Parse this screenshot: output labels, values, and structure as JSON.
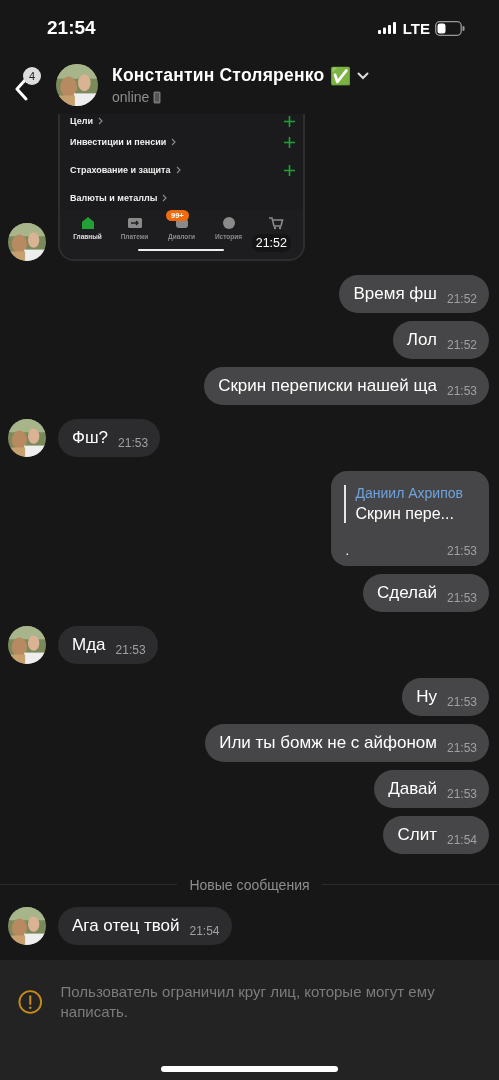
{
  "status_bar": {
    "time": "21:54",
    "network": "LTE"
  },
  "header": {
    "back_badge": "4",
    "name": "Константин Столяренко",
    "name_emoji": "✅",
    "status": "online"
  },
  "messages": [
    {
      "outgoing": false,
      "time": "21:52",
      "screenshot": {
        "rows": [
          "Цели",
          "Инвестиции и пенсии",
          "Страхование и защита",
          "Валюты и металлы"
        ],
        "tabs": [
          {
            "label": "Главный",
            "selected": true
          },
          {
            "label": "Платежи",
            "selected": false
          },
          {
            "label": "Диалоги",
            "selected": false,
            "badge": "99+"
          },
          {
            "label": "История",
            "selected": false
          },
          {
            "selected": false
          }
        ]
      }
    },
    {
      "kind": "text",
      "outgoing": true,
      "text": "Время фш",
      "time": "21:52"
    },
    {
      "kind": "text",
      "outgoing": true,
      "text": "Лол",
      "time": "21:52"
    },
    {
      "kind": "text",
      "outgoing": true,
      "text": "Скрин переписки нашей ща",
      "time": "21:53"
    },
    {
      "kind": "text",
      "outgoing": false,
      "text": "Фш?",
      "time": "21:53"
    },
    {
      "kind": "reply",
      "outgoing": true,
      "reply_author": "Даниил Ахрипов",
      "reply_text": "Скрин пере...",
      "text": ".",
      "time": "21:53"
    },
    {
      "kind": "text",
      "outgoing": true,
      "text": "Сделай",
      "time": "21:53"
    },
    {
      "kind": "text",
      "outgoing": false,
      "text": "Мда",
      "time": "21:53"
    },
    {
      "kind": "text",
      "outgoing": true,
      "text": "Ну",
      "time": "21:53"
    },
    {
      "kind": "text",
      "outgoing": true,
      "text": "Или ты бомж не с айфоном",
      "time": "21:53"
    },
    {
      "kind": "text",
      "outgoing": true,
      "text": "Давай",
      "time": "21:53"
    },
    {
      "kind": "text",
      "outgoing": true,
      "text": "Слит",
      "time": "21:54"
    },
    {
      "kind": "divider",
      "text": "Новые сообщения"
    },
    {
      "kind": "text",
      "outgoing": false,
      "text": "Ага отец твой",
      "time": "21:54"
    }
  ],
  "notice": {
    "text": "Пользователь ограничил круг лиц, которые могут ему написать."
  }
}
